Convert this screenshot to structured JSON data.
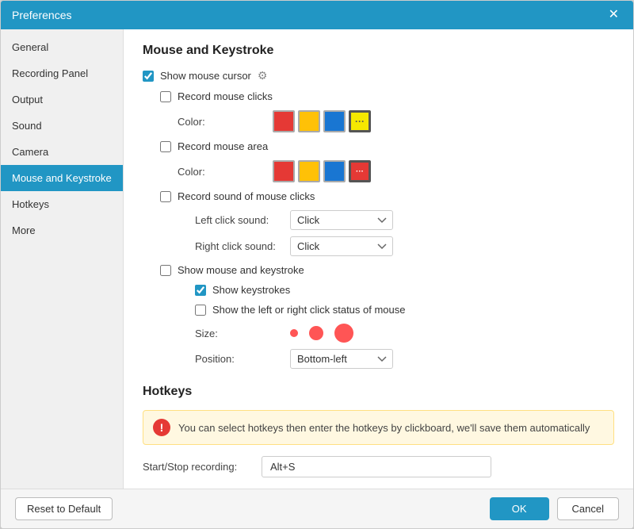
{
  "titleBar": {
    "title": "Preferences",
    "closeIcon": "✕"
  },
  "sidebar": {
    "items": [
      {
        "id": "general",
        "label": "General",
        "active": false
      },
      {
        "id": "recording-panel",
        "label": "Recording Panel",
        "active": false
      },
      {
        "id": "output",
        "label": "Output",
        "active": false
      },
      {
        "id": "sound",
        "label": "Sound",
        "active": false
      },
      {
        "id": "camera",
        "label": "Camera",
        "active": false
      },
      {
        "id": "mouse-and-keystroke",
        "label": "Mouse and Keystroke",
        "active": true
      },
      {
        "id": "hotkeys",
        "label": "Hotkeys",
        "active": false
      },
      {
        "id": "more",
        "label": "More",
        "active": false
      }
    ]
  },
  "mouseKeystroke": {
    "sectionTitle": "Mouse and Keystroke",
    "showMouseCursor": {
      "label": "Show mouse cursor",
      "checked": true
    },
    "recordMouseClicks": {
      "label": "Record mouse clicks",
      "checked": false,
      "colorLabel": "Color:",
      "colors": [
        "#e53935",
        "#ffc107",
        "#1976d2",
        "#f5e800"
      ],
      "moreDotsLabel": "..."
    },
    "recordMouseArea": {
      "label": "Record mouse area",
      "checked": false,
      "colorLabel": "Color:",
      "colors": [
        "#e53935",
        "#ffc107",
        "#1976d2",
        "#e53935"
      ],
      "selectedIndex": 3
    },
    "recordSoundOfMouseClicks": {
      "label": "Record sound of mouse clicks",
      "checked": false,
      "leftClickSoundLabel": "Left click sound:",
      "leftClickSoundValue": "Click",
      "rightClickSoundLabel": "Right click sound:",
      "rightClickSoundValue": "Click"
    },
    "showMouseAndKeystroke": {
      "label": "Show mouse and keystroke",
      "checked": false,
      "showKeystrokes": {
        "label": "Show keystrokes",
        "checked": true
      },
      "showClickStatus": {
        "label": "Show the left or right click status of mouse",
        "checked": false
      },
      "sizeLabel": "Size:",
      "positionLabel": "Position:",
      "positionValue": "Bottom-left"
    }
  },
  "hotkeys": {
    "sectionTitle": "Hotkeys",
    "infoBanner": "You can select hotkeys then enter the hotkeys by clickboard, we'll save them automatically",
    "startStopLabel": "Start/Stop recording:",
    "startStopValue": "Alt+S"
  },
  "footer": {
    "resetLabel": "Reset to Default",
    "okLabel": "OK",
    "cancelLabel": "Cancel"
  }
}
